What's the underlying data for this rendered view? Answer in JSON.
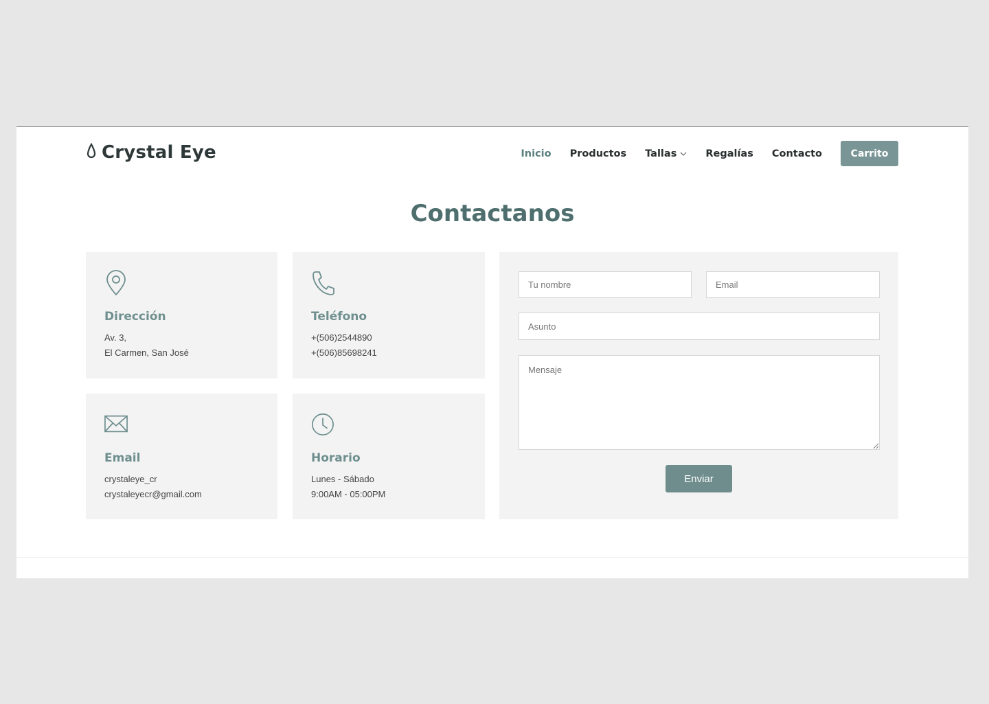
{
  "header": {
    "logo_text": "Crystal Eye",
    "nav": [
      "Inicio",
      "Productos",
      "Tallas",
      "Regalías",
      "Contacto"
    ],
    "active_nav": "Inicio",
    "cart_label": "Carrito"
  },
  "main": {
    "title": "Contactanos",
    "cards": [
      {
        "icon": "map-pin-icon",
        "title": "Dirección",
        "line1": "Av. 3,",
        "line2": "El Carmen, San José"
      },
      {
        "icon": "phone-icon",
        "title": "Teléfono",
        "line1": "+(506)2544890",
        "line2": "+(506)85698241"
      },
      {
        "icon": "envelope-icon",
        "title": "Email",
        "line1": "crystaleye_cr",
        "line2": "crystaleyecr@gmail.com"
      },
      {
        "icon": "clock-icon",
        "title": "Horario",
        "line1": "Lunes - Sábado",
        "line2": "9:00AM - 05:00PM"
      }
    ],
    "form": {
      "name_placeholder": "Tu nombre",
      "email_placeholder": "Email",
      "subject_placeholder": "Asunto",
      "message_placeholder": "Mensaje",
      "submit_label": "Enviar"
    }
  },
  "colors": {
    "accent": "#6f8d8d",
    "title": "#4f6f6f",
    "card_bg": "#f3f3f3",
    "page_bg": "#e7e7e7"
  }
}
